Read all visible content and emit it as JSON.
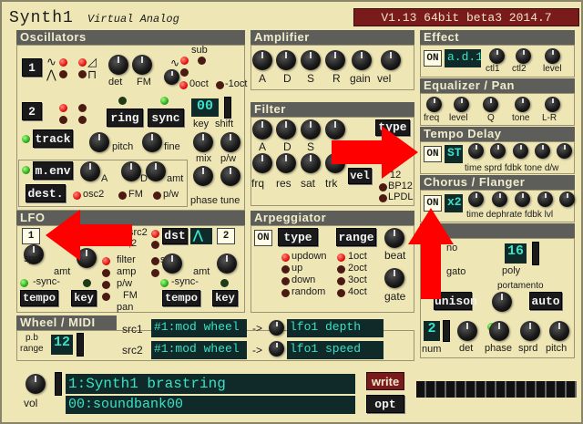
{
  "app": {
    "title": "Synth1",
    "subtitle": "Virtual Analog",
    "version": "V1.13 64bit beta3 2014.7"
  },
  "sections": {
    "osc": "Oscillators",
    "amp": "Amplifier",
    "filter": "Filter",
    "effect": "Effect",
    "eq": "Equalizer / Pan",
    "tempo_delay": "Tempo Delay",
    "chorus": "Chorus / Flanger",
    "lfo": "LFO",
    "arp": "Arpeggiator",
    "voice": "ce",
    "wheel": "Wheel / MIDI"
  },
  "osc": {
    "osc1_btn": "1",
    "osc2_btn": "2",
    "det": "det",
    "fm": "FM",
    "sub": "sub",
    "oct0": "0oct",
    "oct1": "-1oct",
    "ring": "ring",
    "sync": "sync",
    "track": "track",
    "pitch": "pitch",
    "fine": "fine",
    "shift_value": "00",
    "key": "key",
    "shift": "shift",
    "mix": "mix",
    "pw": "p/w",
    "phase": "phase",
    "tune": "tune",
    "menv": "m.env",
    "dest": "dest.",
    "a": "A",
    "d": "D",
    "amt": "amt",
    "osc2": "osc2",
    "fm2": "FM",
    "pw2": "p/w"
  },
  "amp": {
    "a": "A",
    "d": "D",
    "s": "S",
    "r": "R",
    "gain": "gain",
    "vel": "vel"
  },
  "filter": {
    "type": "type",
    "a": "A",
    "d": "D",
    "s": "S",
    "frq": "frq",
    "res": "res",
    "sat": "sat",
    "trk": "trk",
    "vel": "vel",
    "bp12": "BP12",
    "lpdl": "LPDL",
    "n12": "12"
  },
  "effect": {
    "on": "ON",
    "type": "a.d.1",
    "ctl1": "ctl1",
    "ctl2": "ctl2",
    "level": "level"
  },
  "eq": {
    "freq": "freq",
    "level": "level",
    "q": "Q",
    "tone": "tone",
    "lr": "L-R"
  },
  "delay": {
    "on": "ON",
    "st": "ST",
    "labels": "time sprd fdbk tone d/w"
  },
  "chorus": {
    "on": "ON",
    "x2": "x2",
    "labels": "time dephrate fdbk lvl"
  },
  "lfo": {
    "one": "1",
    "two": "2",
    "dst": "dst",
    "src2": "src2",
    "src12": ",2",
    "spd": "spd",
    "amt": "amt",
    "sync": "-sync-",
    "tempo": "tempo",
    "key": "key",
    "filter": "filter",
    "ampl": "amp",
    "pw": "p/w",
    "fm": "FM",
    "pan": "pan"
  },
  "arp": {
    "on": "ON",
    "type": "type",
    "range": "range",
    "beat": "beat",
    "gate": "gate",
    "modes": [
      "updown",
      "up",
      "down",
      "random"
    ],
    "ranges": [
      "1oct",
      "2oct",
      "3oct",
      "4oct"
    ]
  },
  "voice": {
    "poly_value": "16",
    "poly": "poly",
    "no": "no",
    "gato": "gato",
    "portamento": "portamento",
    "auto": "auto",
    "unison": "unison",
    "num_value": "2",
    "num": "num",
    "det": "det",
    "phase": "phase",
    "sprd": "sprd",
    "pitch": "pitch"
  },
  "wheel": {
    "pb": "p.b",
    "range": "range",
    "pb_value": "12",
    "src1": "src1",
    "src2": "src2",
    "src1_val": "#1:mod wheel",
    "src2_val": "#1:mod wheel",
    "arrow": "->",
    "dest1": "lfo1 depth",
    "dest2": "lfo1 speed"
  },
  "patch": {
    "vol": "vol",
    "name": "1:Synth1 brastring",
    "bank": "00:soundbank00",
    "write": "write",
    "opt": "opt"
  }
}
